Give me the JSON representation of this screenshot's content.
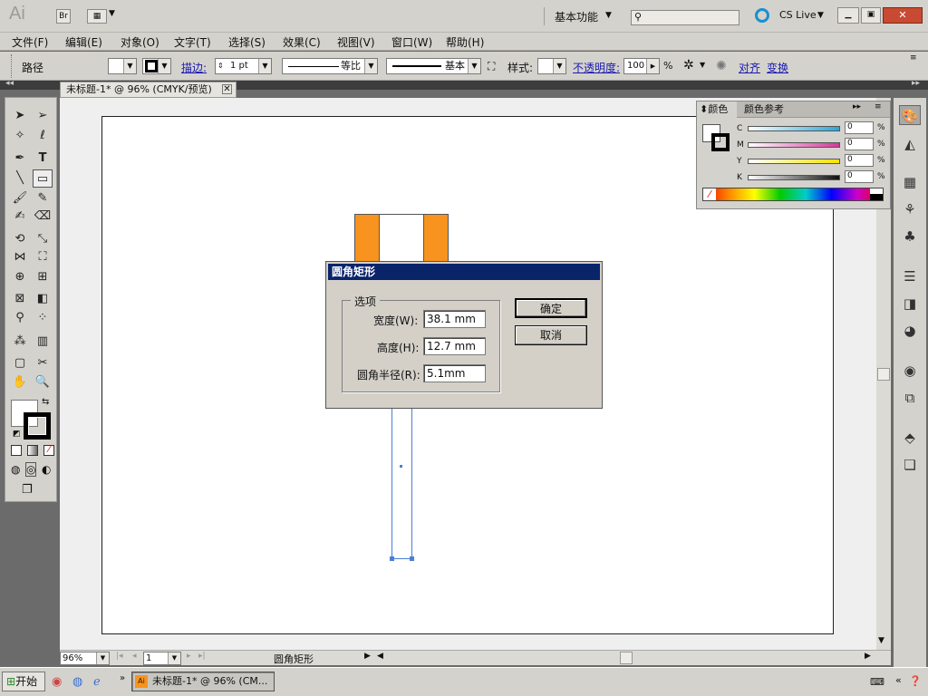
{
  "app": {
    "logo": "Ai",
    "bridge": "Br",
    "workspace": "基本功能",
    "search_placeholder": "",
    "cslive": "CS Live"
  },
  "window_controls": {
    "minimize": "▁",
    "restore": "▣",
    "close": "✕"
  },
  "menu": [
    "文件(F)",
    "编辑(E)",
    "对象(O)",
    "文字(T)",
    "选择(S)",
    "效果(C)",
    "视图(V)",
    "窗口(W)",
    "帮助(H)"
  ],
  "control": {
    "label": "路径",
    "stroke_label": "描边:",
    "stroke_value": "1 pt",
    "profile": "等比",
    "brush": "基本",
    "style_label": "样式:",
    "opacity_label": "不透明度:",
    "opacity_value": "100",
    "percent": "%",
    "align": "对齐",
    "transform": "变换"
  },
  "document": {
    "tab": "未标题-1* @ 96% (CMYK/预览)"
  },
  "color_panel": {
    "tab_color": "颜色",
    "tab_guide": "颜色参考",
    "channels": [
      {
        "name": "C",
        "value": "0",
        "color": "#2aa7d9"
      },
      {
        "name": "M",
        "value": "0",
        "color": "#d4389b"
      },
      {
        "name": "Y",
        "value": "0",
        "color": "#f5e400"
      },
      {
        "name": "K",
        "value": "0",
        "color": "#111111"
      }
    ],
    "percent": "%"
  },
  "artwork": {
    "orange": "#f7931e",
    "selection": "#4a7fd6"
  },
  "dialog": {
    "title": "圆角矩形",
    "group": "选项",
    "width_label": "宽度(W):",
    "width_value": "38.1 mm",
    "height_label": "高度(H):",
    "height_value": "12.7 mm",
    "radius_label": "圆角半径(R):",
    "radius_value": "5.1mm",
    "ok": "确定",
    "cancel": "取消"
  },
  "status": {
    "zoom": "96%",
    "page": "1",
    "tool_name": "圆角矩形"
  },
  "taskbar": {
    "start": "开始",
    "task": "未标题-1* @ 96% (CM..."
  }
}
